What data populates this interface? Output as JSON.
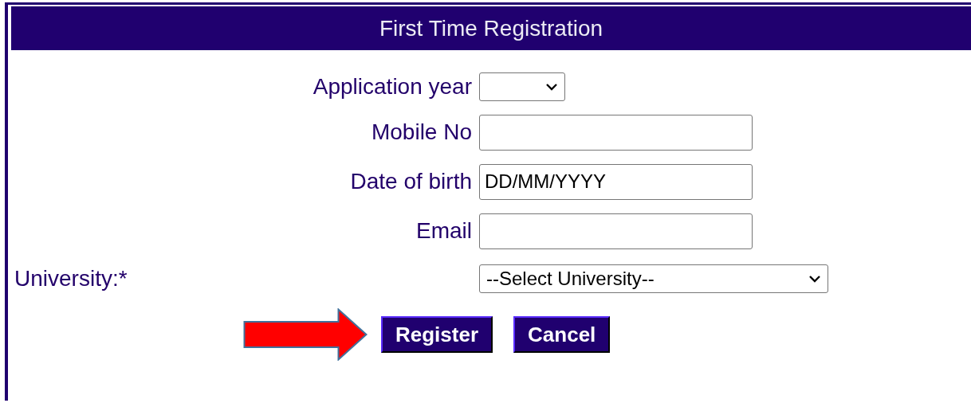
{
  "header": {
    "title": "First Time Registration"
  },
  "fields": [
    {
      "label": "Application year",
      "kind": "select"
    },
    {
      "label": "Mobile No",
      "kind": "text"
    },
    {
      "label": "Date of birth",
      "kind": "text",
      "value": "DD/MM/YYYY"
    },
    {
      "label": "Email",
      "kind": "text"
    }
  ],
  "university": {
    "label": "University:*",
    "value": "--Select University--"
  },
  "buttons": [
    {
      "label": "Register"
    },
    {
      "label": "Cancel"
    }
  ]
}
